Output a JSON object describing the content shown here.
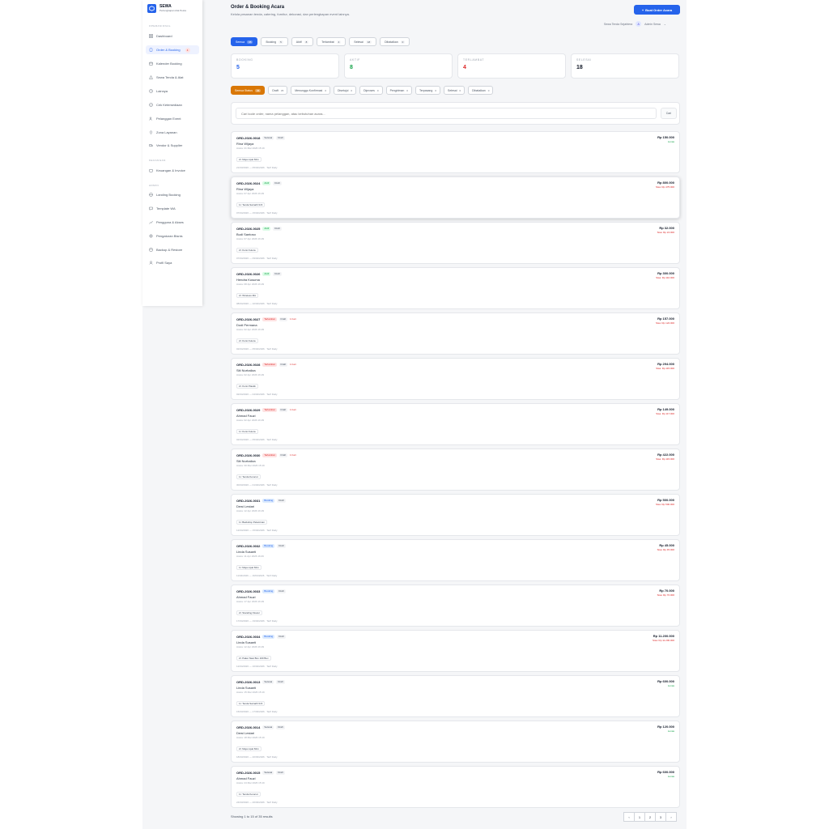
{
  "app": {
    "name": "SEWA",
    "subtitle": "Perlengkapan Alat Pesta"
  },
  "sidebar": {
    "sections": [
      {
        "label": "OPERASIONAL",
        "items": [
          {
            "label": "Dashboard",
            "icon": "grid-icon"
          },
          {
            "label": "Order & Booking",
            "icon": "clipboard-icon",
            "active": true,
            "badge": "4"
          },
          {
            "label": "Kalender Booking",
            "icon": "calendar-icon"
          },
          {
            "label": "Sewa Tenda & Alat",
            "icon": "tent-icon"
          },
          {
            "label": "Lainnya",
            "icon": "clock-icon"
          },
          {
            "label": "Cek Ketersediaan",
            "icon": "check-circle-icon"
          },
          {
            "label": "Pelanggan Event",
            "icon": "users-icon"
          },
          {
            "label": "Zona Layanan",
            "icon": "map-pin-icon"
          },
          {
            "label": "Vendor & Supplier",
            "icon": "truck-icon"
          }
        ]
      },
      {
        "label": "KEUANGAN",
        "items": [
          {
            "label": "Keuangan & Invoice",
            "icon": "wallet-icon"
          }
        ]
      },
      {
        "label": "ADMIN",
        "items": [
          {
            "label": "Landing Booking",
            "icon": "globe-icon"
          },
          {
            "label": "Template WA",
            "icon": "message-icon"
          },
          {
            "label": "Pengguna & Akses",
            "icon": "chart-icon"
          },
          {
            "label": "Pengaturan Bisnis",
            "icon": "gear-icon"
          },
          {
            "label": "Backup & Restore",
            "icon": "database-icon"
          },
          {
            "label": "Profil Saya",
            "icon": "user-icon"
          }
        ]
      }
    ]
  },
  "header": {
    "title": "Order & Booking Acara",
    "subtitle": "Kelola pesanan tenda, catering, furnitur, dekorasi, dan perlengkapan event lainnya.",
    "new_button": "Buat Order Acara",
    "business": "Sewa Tenda Sejahtera",
    "avatar_initial": "A",
    "user": "Admin Sewa"
  },
  "status_tabs": [
    {
      "label": "Semua",
      "count": "35",
      "active": true
    },
    {
      "label": "Booking",
      "count": "5"
    },
    {
      "label": "Aktif",
      "count": "8"
    },
    {
      "label": "Terlambat",
      "count": "4"
    },
    {
      "label": "Selesai",
      "count": "18"
    },
    {
      "label": "Dibatalkan",
      "count": "0"
    }
  ],
  "stats": [
    {
      "label": "BOOKING",
      "value": "5",
      "color": "#2563eb"
    },
    {
      "label": "AKTIF",
      "value": "8",
      "color": "#16a34a"
    },
    {
      "label": "TERLAMBAT",
      "value": "4",
      "color": "#dc2626"
    },
    {
      "label": "SELESAI",
      "value": "18",
      "color": "#111827"
    }
  ],
  "pay_tabs": [
    {
      "label": "Semua Status",
      "count": "35",
      "active": true
    },
    {
      "label": "Draft",
      "count": "35"
    },
    {
      "label": "Menunggu Konfirmasi",
      "count": "0"
    },
    {
      "label": "Disetujui",
      "count": "0"
    },
    {
      "label": "Diproses",
      "count": "0"
    },
    {
      "label": "Pengiriman",
      "count": "0"
    },
    {
      "label": "Terpasang",
      "count": "0"
    },
    {
      "label": "Selesai",
      "count": "0"
    },
    {
      "label": "Dibatalkan",
      "count": "0"
    }
  ],
  "search": {
    "placeholder": "Cari kode order, nama pelanggan, atau kebutuhan acara...",
    "button": "Cari"
  },
  "orders": [
    {
      "code": "ORD-2026-0018",
      "status": "Selesai",
      "pay": "Draft",
      "late": "",
      "customer": "Rina Wijaya",
      "meta": "Acara: 21 Mar 2026 15:19",
      "item": "2× Meja Lipat 60m",
      "dates": "21/03/2026 — 05/04/2026 · Tarif Daily",
      "amount": "Rp 150.000",
      "sub": "Lunas",
      "sub_type": "lunas"
    },
    {
      "code": "ORD-2026-0024",
      "status": "Aktif",
      "pay": "Draft",
      "late": "",
      "customer": "Rina Wijaya",
      "meta": "Acara: 07 Apr 2026 16:29",
      "item": "1× Tenda Sarnafil 3×6",
      "dates": "07/04/2026 — 15/04/2026 · Tarif Daily",
      "amount": "Rp 800.000",
      "sub": "Sisa: Rp 475.000",
      "sub_type": "sisa"
    },
    {
      "code": "ORD-2026-0025",
      "status": "Aktif",
      "pay": "Draft",
      "late": "",
      "customer": "Budi Santoso",
      "meta": "Acara: 07 Apr 2026 16:29",
      "item": "2× Kursi Futura",
      "dates": "07/04/2026 — 09/04/2026 · Tarif Daily",
      "amount": "Rp 32.000",
      "sub": "Sisa: Rp 24.000",
      "sub_type": "sisa"
    },
    {
      "code": "ORD-2026-0026",
      "status": "Aktif",
      "pay": "Draft",
      "late": "",
      "customer": "Hendra Kusuma",
      "meta": "Acara: 08 Apr 2026 16:29",
      "item": "2× Wireless Mic",
      "dates": "08/04/2026 — 10/04/2026 · Tarif Daily",
      "amount": "Rp 300.000",
      "sub": "Sisa: Rp 110.000",
      "sub_type": "sisa"
    },
    {
      "code": "ORD-2026-0027",
      "status": "Terlambat",
      "pay": "Draft",
      "late": "1 hari",
      "customer": "Dodi Permana",
      "meta": "Acara: 02 Apr 2026 16:29",
      "item": "2× Kursi Futura",
      "dates": "02/04/2026 — 05/04/2026 · Tarif Daily",
      "amount": "Rp 157.000",
      "sub": "Sisa: Rp 122.000",
      "sub_type": "sisa"
    },
    {
      "code": "ORD-2026-0028",
      "status": "Terlambat",
      "pay": "Draft",
      "late": "1 hari",
      "customer": "Siti Nurhaliza",
      "meta": "Acara: 02 Apr 2026 16:29",
      "item": "2× Kursi Plastik",
      "dates": "02/04/2026 — 04/04/2026 · Tarif Daily",
      "amount": "Rp 294.000",
      "sub": "Sisa: Rp 115.000",
      "sub_type": "sisa"
    },
    {
      "code": "ORD-2026-0029",
      "status": "Terlambat",
      "pay": "Draft",
      "late": "1 hari",
      "customer": "Ahmad Fauzi",
      "meta": "Acara: 02 Apr 2026 16:29",
      "item": "1× Kursi Futura",
      "dates": "02/04/2026 — 05/04/2026 · Tarif Daily",
      "amount": "Rp 149.000",
      "sub": "Sisa: Rp 117.000",
      "sub_type": "sisa"
    },
    {
      "code": "ORD-2026-0030",
      "status": "Terlambat",
      "pay": "Draft",
      "late": "1 hari",
      "customer": "Siti Nurhaliza",
      "meta": "Acara: 30 Mar 2026 15:19",
      "item": "1× Tenda Kerucut",
      "dates": "30/03/2026 — 01/04/2026 · Tarif Daily",
      "amount": "Rp 422.000",
      "sub": "Sisa: Rp 115.000",
      "sub_type": "sisa"
    },
    {
      "code": "ORD-2026-0031",
      "status": "Booking",
      "pay": "Draft",
      "late": "",
      "customer": "Dewi Lestari",
      "meta": "Acara: 12 Apr 2026 16:29",
      "item": "1× Backdrop Pelaminan",
      "dates": "12/04/2026 — 15/04/2026 · Tarif Daily",
      "amount": "Rp 500.000",
      "sub": "Sisa: Rp 500.000",
      "sub_type": "sisa"
    },
    {
      "code": "ORD-2026-0032",
      "status": "Booking",
      "pay": "Draft",
      "late": "",
      "customer": "Linda Susanti",
      "meta": "Acara: 11 Apr 2026 16:29",
      "item": "1× Meja Lipat 60m",
      "dates": "11/04/2026 — 16/04/2026 · Tarif Daily",
      "amount": "Rp 45.000",
      "sub": "Sisa: Rp 45.000",
      "sub_type": "sisa"
    },
    {
      "code": "ORD-2026-0033",
      "status": "Booking",
      "pay": "Draft",
      "late": "",
      "customer": "Ahmad Fauzi",
      "meta": "Acara: 17 Apr 2026 16:29",
      "item": "2× Standing Flower",
      "dates": "17/04/2026 — 19/04/2026 · Tarif Daily",
      "amount": "Rp 70.000",
      "sub": "Sisa: Rp 70.000",
      "sub_type": "sisa"
    },
    {
      "code": "ORD-2026-0034",
      "status": "Booking",
      "pay": "Draft",
      "late": "",
      "customer": "Linda Susanti",
      "meta": "Acara: 12 Apr 2026 16:29",
      "item": "2× Paket Nasi Box 100 Box",
      "dates": "12/04/2026 — 16/04/2026 · Tarif Daily",
      "amount": "Rp 11.200.000",
      "sub": "Sisa: Rp 11.200.000",
      "sub_type": "sisa"
    },
    {
      "code": "ORD-2026-0013",
      "status": "Selesai",
      "pay": "Draft",
      "late": "",
      "customer": "Linda Susanti",
      "meta": "Acara: 15 Mar 2026 15:19",
      "item": "1× Tenda Sarnafil 3×6",
      "dates": "15/03/2026 — 17/03/2026 · Tarif Daily",
      "amount": "Rp 600.000",
      "sub": "Lunas",
      "sub_type": "lunas"
    },
    {
      "code": "ORD-2026-0014",
      "status": "Selesai",
      "pay": "Draft",
      "late": "",
      "customer": "Dewi Lestari",
      "meta": "Acara: 18 Mar 2026 15:19",
      "item": "2× Meja Lipat 60m",
      "dates": "18/03/2026 — 20/03/2026 · Tarif Daily",
      "amount": "Rp 120.000",
      "sub": "Lunas",
      "sub_type": "lunas"
    },
    {
      "code": "ORD-2026-0015",
      "status": "Selesai",
      "pay": "Draft",
      "late": "",
      "customer": "Ahmad Fauzi",
      "meta": "Acara: 24 Mar 2026 15:19",
      "item": "1× Tenda Kerucut",
      "dates": "24/03/2026 — 26/03/2026 · Tarif Daily",
      "amount": "Rp 600.000",
      "sub": "Lunas",
      "sub_type": "lunas"
    }
  ],
  "footer": {
    "showing": "Showing 1 to 15 of 35 results",
    "pages": [
      "‹",
      "1",
      "2",
      "3",
      "›"
    ]
  }
}
